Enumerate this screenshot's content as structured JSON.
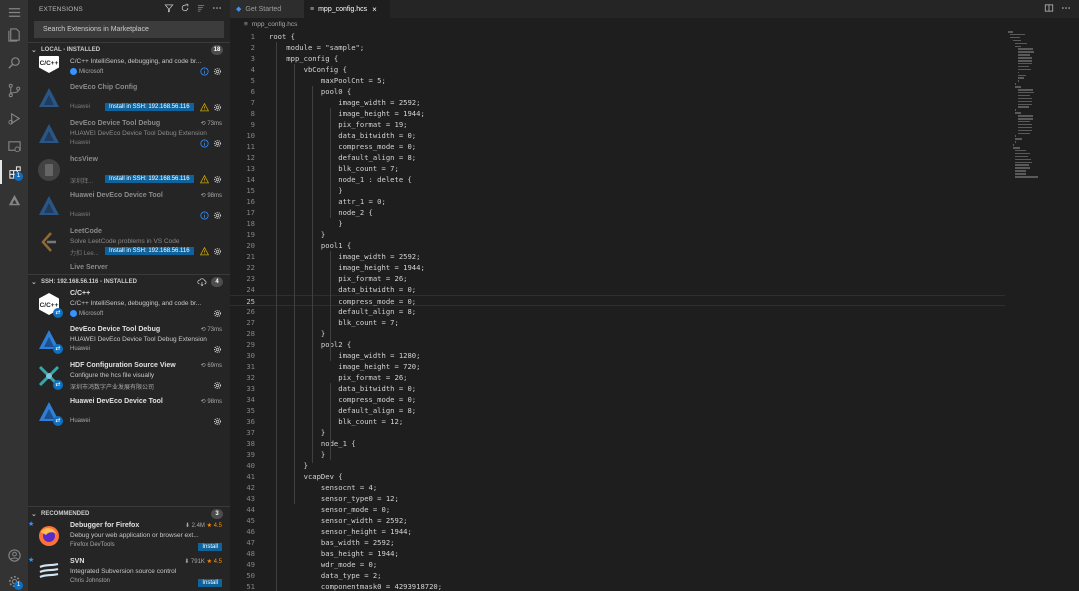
{
  "activity_bar": {
    "items": [
      {
        "icon": "menu-icon"
      },
      {
        "icon": "explorer-icon"
      },
      {
        "icon": "search-icon"
      },
      {
        "icon": "source-control-icon"
      },
      {
        "icon": "run-debug-icon"
      },
      {
        "icon": "remote-explorer-icon"
      },
      {
        "icon": "extensions-icon",
        "badge": "1"
      },
      {
        "icon": "deveco-icon"
      }
    ],
    "bottom": [
      {
        "icon": "account-icon"
      },
      {
        "icon": "manage-gear-icon",
        "badge": "1"
      }
    ]
  },
  "sidebar": {
    "title": "EXTENSIONS",
    "search_placeholder": "Search Extensions in Marketplace",
    "local": {
      "label": "LOCAL - INSTALLED",
      "count": "18",
      "items": [
        {
          "name": "C/C++",
          "desc": "C/C++ IntelliSense, debugging, and code br...",
          "publisher": "Microsoft",
          "verified": true,
          "dim": false,
          "status": "info"
        },
        {
          "name": "DevEco Chip Config",
          "desc": "",
          "publisher": "Huawei",
          "install_btn": "Install in SSH: 192.168.56.116",
          "dim": true,
          "status": "warn"
        },
        {
          "name": "DevEco Device Tool Debug",
          "desc": "HUAWEI DevEco Device Tool Debug Extension",
          "publisher": "Huawei",
          "meta": "73ms",
          "dim": true,
          "status": "info"
        },
        {
          "name": "hcsView",
          "desc": "",
          "publisher": "深圳拜...",
          "install_btn": "Install in SSH: 192.168.56.116",
          "dim": true,
          "status": "warn"
        },
        {
          "name": "Huawei DevEco Device Tool",
          "desc": "",
          "publisher": "Huawei",
          "meta": "98ms",
          "dim": true,
          "status": "info"
        },
        {
          "name": "LeetCode",
          "desc": "Solve LeetCode problems in VS Code",
          "publisher": "力扣 Lee...",
          "install_btn": "Install in SSH: 192.168.56.116",
          "dim": true,
          "status": "warn"
        },
        {
          "name": "Live Server",
          "desc": "",
          "publisher": "",
          "dim": true
        }
      ]
    },
    "ssh": {
      "label": "SSH: 192.168.56.116 - INSTALLED",
      "count": "4",
      "items": [
        {
          "name": "C/C++",
          "desc": "C/C++ IntelliSense, debugging, and code br...",
          "publisher": "Microsoft",
          "verified": true,
          "meta": ""
        },
        {
          "name": "DevEco Device Tool Debug",
          "desc": "HUAWEI DevEco Device Tool Debug Extension",
          "publisher": "Huawei",
          "meta": "73ms"
        },
        {
          "name": "HDF Configuration Source View",
          "desc": "Configure the hcs file visually",
          "publisher": "深圳市鸿数字产业发展有限公司",
          "meta": "69ms"
        },
        {
          "name": "Huawei DevEco Device Tool",
          "desc": "",
          "publisher": "Huawei",
          "meta": "98ms"
        }
      ]
    },
    "recommended": {
      "label": "RECOMMENDED",
      "count": "3",
      "items": [
        {
          "name": "Debugger for Firefox",
          "desc": "Debug your web application or browser ext...",
          "publisher": "Firefox DevTools",
          "downloads": "2.4M",
          "rating": "4.5",
          "install_btn": "Install"
        },
        {
          "name": "SVN",
          "desc": "Integrated Subversion source control",
          "publisher": "Chris Johnston",
          "downloads": "791K",
          "rating": "4.5",
          "install_btn": "Install"
        }
      ]
    }
  },
  "tabs": [
    {
      "label": "Get Started",
      "active": false
    },
    {
      "label": "mpp_config.hcs",
      "active": true,
      "close": "×"
    }
  ],
  "breadcrumb": "mpp_config.hcs",
  "editor": {
    "current_line": 25,
    "lines": [
      "root {",
      "    module = \"sample\";",
      "    mpp_config {",
      "        vbConfig {",
      "            maxPoolCnt = 5;",
      "            pool0 {",
      "                image_width = 2592;",
      "                image_height = 1944;",
      "                pix_format = 19;",
      "                data_bitwidth = 0;",
      "                compress_mode = 0;",
      "                default_align = 8;",
      "                blk_count = 7;",
      "                node_1 : delete {",
      "                }",
      "                attr_1 = 0;",
      "                node_2 {",
      "                }",
      "            }",
      "            pool1 {",
      "                image_width = 2592;",
      "                image_height = 1944;",
      "                pix_format = 26;",
      "                data_bitwidth = 0;",
      "                compress_mode = 0;",
      "                default_align = 8;",
      "                blk_count = 7;",
      "            }",
      "            pool2 {",
      "                image_width = 1280;",
      "                image_height = 720;",
      "                pix_format = 26;",
      "                data_bitwidth = 0;",
      "                compress_mode = 0;",
      "                default_align = 8;",
      "                blk_count = 12;",
      "            }",
      "            node_1 {",
      "            }",
      "        }",
      "        vcapDev {",
      "            sensocnt = 4;",
      "            sensor_type0 = 12;",
      "            sensor_mode = 0;",
      "            sensor_width = 2592;",
      "            sensor_height = 1944;",
      "            bas_width = 2592;",
      "            bas_height = 1944;",
      "            wdr_mode = 0;",
      "            data_type = 2;",
      "            componentmask0 = 4293918720;"
    ]
  }
}
